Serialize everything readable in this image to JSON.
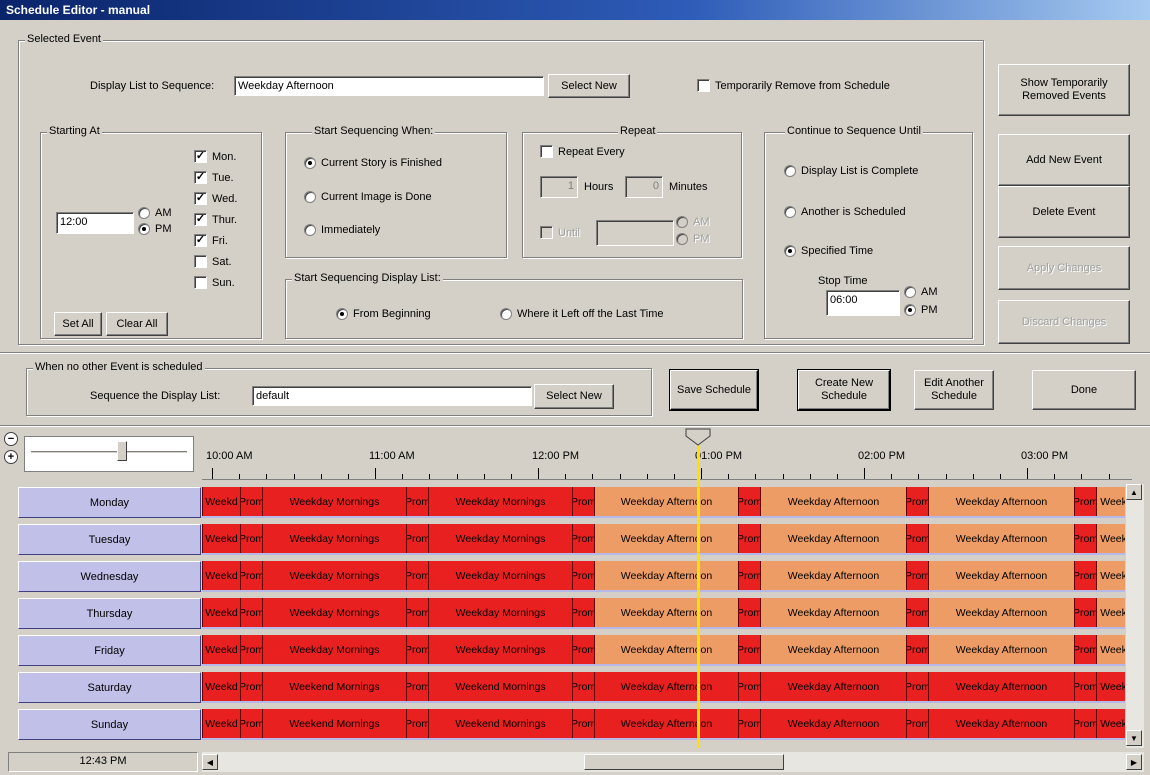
{
  "window": {
    "title": "Schedule Editor - manual"
  },
  "selected_event": {
    "legend": "Selected Event",
    "display_list_label": "Display List to Sequence:",
    "display_list_value": "Weekday Afternoon",
    "select_new": "Select New",
    "temp_remove_label": "Temporarily Remove from Schedule",
    "temp_remove_checked": false
  },
  "starting_at": {
    "legend": "Starting At",
    "time": "12:00",
    "am": "AM",
    "pm": "PM",
    "am_selected": false,
    "pm_selected": true,
    "days": [
      {
        "label": "Mon.",
        "checked": true
      },
      {
        "label": "Tue.",
        "checked": true
      },
      {
        "label": "Wed.",
        "checked": true
      },
      {
        "label": "Thur.",
        "checked": true
      },
      {
        "label": "Fri.",
        "checked": true
      },
      {
        "label": "Sat.",
        "checked": false
      },
      {
        "label": "Sun.",
        "checked": false
      }
    ],
    "set_all": "Set All",
    "clear_all": "Clear All"
  },
  "start_when": {
    "legend": "Start Sequencing When:",
    "options": [
      "Current Story is Finished",
      "Current Image is Done",
      "Immediately"
    ],
    "selected": 0
  },
  "repeat": {
    "legend": "Repeat",
    "repeat_every": "Repeat Every",
    "hours_value": "1",
    "hours_label": "Hours",
    "minutes_value": "0",
    "minutes_label": "Minutes",
    "until": "Until",
    "am": "AM",
    "pm": "PM"
  },
  "start_display": {
    "legend": "Start Sequencing Display List:",
    "options": [
      "From Beginning",
      "Where it Left off the Last Time"
    ],
    "selected": 0
  },
  "continue_until": {
    "legend": "Continue to Sequence Until",
    "options": [
      "Display List is Complete",
      "Another is Scheduled",
      "Specified Time"
    ],
    "selected": 2,
    "stop_time_label": "Stop Time",
    "stop_time": "06:00",
    "am": "AM",
    "pm": "PM"
  },
  "side_buttons": {
    "show_removed": "Show Temporarily Removed Events",
    "add_new": "Add New Event",
    "delete": "Delete Event",
    "apply": "Apply Changes",
    "discard": "Discard Changes"
  },
  "default_event": {
    "legend": "When no other Event is scheduled",
    "label": "Sequence the Display List:",
    "value": "default",
    "select_new": "Select New"
  },
  "bottom_buttons": {
    "save": "Save Schedule",
    "create": "Create New Schedule",
    "edit": "Edit Another Schedule",
    "done": "Done"
  },
  "timeline": {
    "hour_labels": [
      "10:00 AM",
      "11:00 AM",
      "12:00 PM",
      "01:00 PM",
      "02:00 PM",
      "03:00 PM"
    ],
    "current_time": "12:43 PM",
    "days": [
      "Monday",
      "Tuesday",
      "Wednesday",
      "Thursday",
      "Friday",
      "Saturday",
      "Sunday"
    ],
    "weekday_segments": [
      {
        "text": "Weekd",
        "color": "red"
      },
      {
        "text": "Prom",
        "color": "red"
      },
      {
        "text": "Weekday Mornings",
        "color": "red"
      },
      {
        "text": "Prom",
        "color": "red"
      },
      {
        "text": "Weekday Mornings",
        "color": "red"
      },
      {
        "text": "Prom",
        "color": "red"
      },
      {
        "text": "Weekday Afternoon",
        "color": "orange"
      },
      {
        "text": "Prom",
        "color": "red"
      },
      {
        "text": "Weekday Afternoon",
        "color": "orange"
      },
      {
        "text": "Prom",
        "color": "red"
      },
      {
        "text": "Weekday Afternoon",
        "color": "orange"
      },
      {
        "text": "Prom",
        "color": "red"
      },
      {
        "text": "Weekd",
        "color": "orange"
      }
    ],
    "weekend_segments": [
      {
        "text": "Weekd",
        "color": "red"
      },
      {
        "text": "Prom",
        "color": "red"
      },
      {
        "text": "Weekend Mornings",
        "color": "red"
      },
      {
        "text": "Prom",
        "color": "red"
      },
      {
        "text": "Weekend Mornings",
        "color": "red"
      },
      {
        "text": "Prom",
        "color": "red"
      },
      {
        "text": "Weekday Afternoon",
        "color": "red"
      },
      {
        "text": "Prom",
        "color": "red"
      },
      {
        "text": "Weekday Afternoon",
        "color": "red"
      },
      {
        "text": "Prom",
        "color": "red"
      },
      {
        "text": "Weekday Afternoon",
        "color": "red"
      },
      {
        "text": "Prom",
        "color": "red"
      },
      {
        "text": "Weekd",
        "color": "red"
      }
    ]
  },
  "colors": {
    "red": "#e82020",
    "orange": "#ec9c64",
    "day_label": "#c0c0e8",
    "now_line": "#ffe000"
  }
}
